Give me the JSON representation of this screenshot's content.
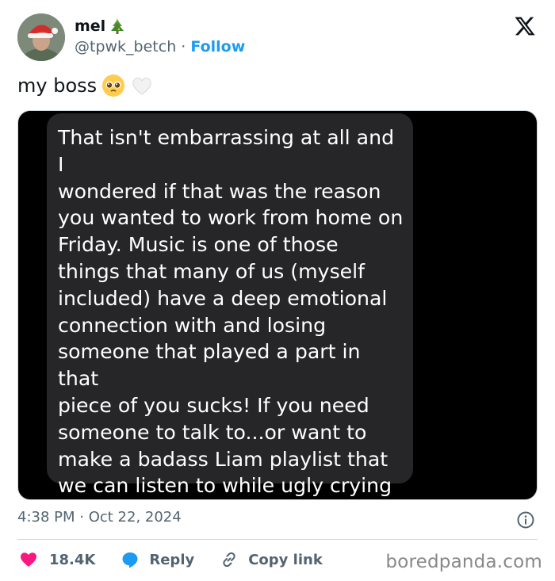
{
  "author": {
    "name": "mel",
    "name_emoji": "christmas-tree-icon",
    "handle": "@tpwk_betch",
    "separator": "·",
    "follow_label": "Follow"
  },
  "platform_logo": "x-logo-icon",
  "tweet": {
    "text": "my boss",
    "emojis": [
      "pleading-face-icon",
      "white-heart-icon"
    ]
  },
  "media": {
    "message": "That isn't embarrassing at all and I\nwondered if that was the reason\nyou wanted to work from home on\nFriday.  Music is one of those\nthings that many of us (myself\nincluded) have a deep emotional\nconnection with and losing\nsomeone that played a part in that\npiece of you sucks! If you need\nsomeone to talk to...or want to\nmake a badass Liam playlist that\nwe can listen to while ugly crying\ntogether, I am here for you!"
  },
  "timestamp": "4:38 PM · Oct 22, 2024",
  "actions": {
    "like_count": "18.4K",
    "reply_label": "Reply",
    "copy_label": "Copy link"
  },
  "watermark": "boredpanda.com",
  "colors": {
    "follow": "#1d9bf0",
    "like": "#f91880",
    "reply": "#1d9bf0",
    "muted": "#536471",
    "bubble": "#262628"
  }
}
